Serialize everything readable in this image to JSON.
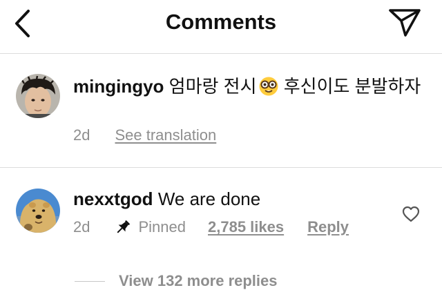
{
  "header": {
    "title": "Comments",
    "back_icon": "chevron-left-icon",
    "send_icon": "send-icon"
  },
  "caption": {
    "username": "mingingyo",
    "text_before_emoji": "엄마랑 전시",
    "emoji": "nerd-face-emoji",
    "text_after_emoji": " 후신이도 분발하자",
    "time": "2d",
    "see_translation": "See translation"
  },
  "comment": {
    "username": "nexxtgod",
    "text": "We are done",
    "time": "2d",
    "pinned_label": "Pinned",
    "likes": "2,785 likes",
    "reply": "Reply",
    "like_icon": "heart-outline-icon"
  },
  "view_replies": "View 132 more replies"
}
